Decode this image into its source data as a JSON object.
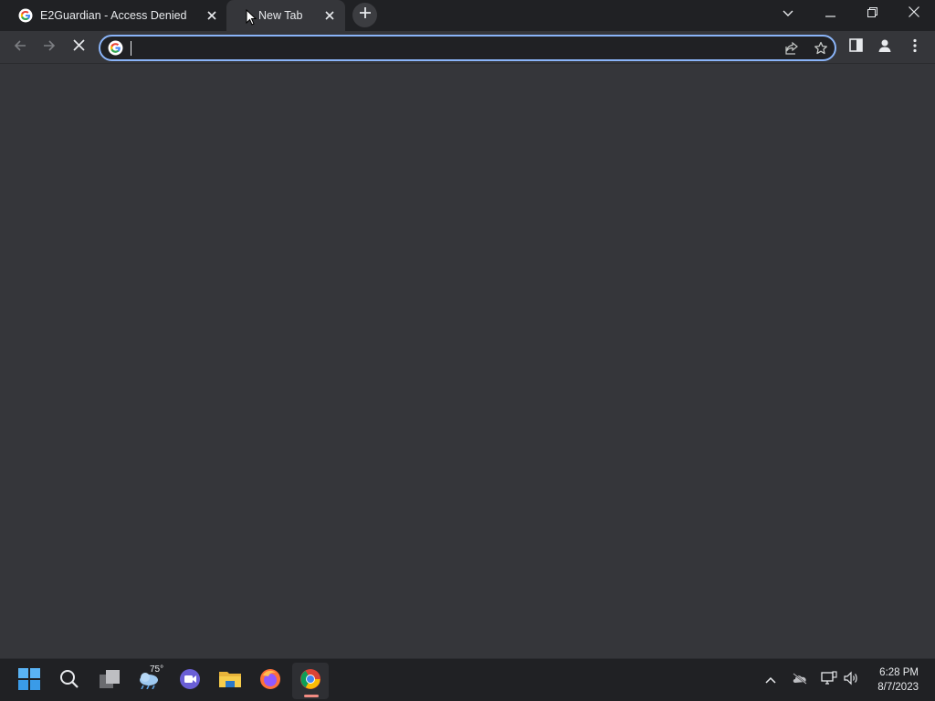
{
  "browser": {
    "tabs": [
      {
        "title": "E2Guardian - Access Denied",
        "favicon": "google-g-icon",
        "active": false
      },
      {
        "title": "New Tab",
        "favicon": "loading",
        "active": true
      }
    ],
    "new_tab_icon": "plus-icon",
    "window_controls": [
      "tab-search-icon",
      "minimize-icon",
      "restore-icon",
      "close-icon"
    ]
  },
  "toolbar": {
    "back_icon": "back-arrow-icon",
    "forward_icon": "forward-arrow-icon",
    "stop_icon": "stop-loading-icon",
    "omnibox": {
      "value": "",
      "placeholder": ""
    },
    "share_icon": "share-icon",
    "bookmark_icon": "star-icon",
    "side_panel_icon": "side-panel-icon",
    "profile_icon": "profile-icon",
    "menu_icon": "kebab-menu-icon"
  },
  "taskbar": {
    "apps": [
      "start-icon",
      "search-icon",
      "task-view-icon",
      "weather-icon",
      "teams-icon",
      "file-explorer-icon",
      "firefox-icon",
      "chrome-icon"
    ],
    "weather_temp": "75°",
    "tray": [
      "chevron-up-icon",
      "onedrive-offline-icon",
      "network-icon",
      "volume-icon"
    ],
    "time": "6:28 PM",
    "date": "8/7/2023"
  },
  "colors": {
    "accent": "#8ab4f8",
    "titlebar": "#202124",
    "toolbar": "#35363a",
    "active_indicator": "#f28b82"
  }
}
